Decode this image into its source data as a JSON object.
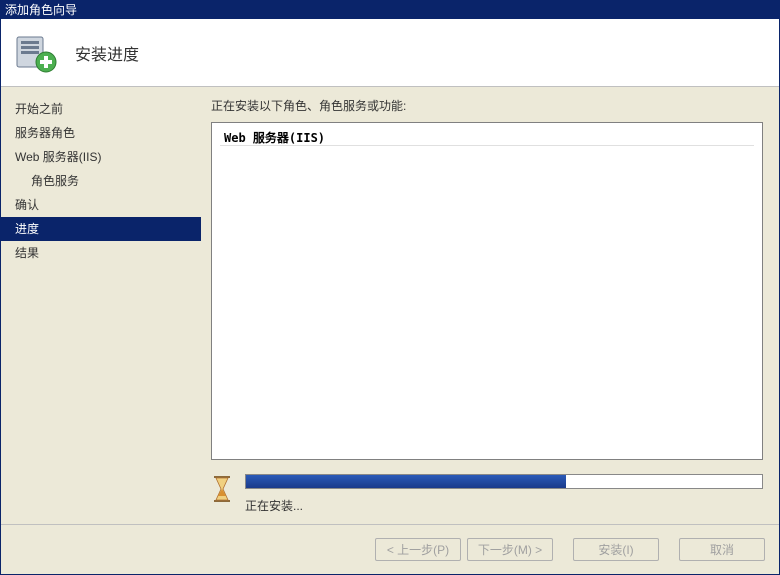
{
  "window": {
    "title": "添加角色向导"
  },
  "header": {
    "title": "安装进度"
  },
  "sidebar": {
    "items": [
      {
        "label": "开始之前"
      },
      {
        "label": "服务器角色"
      },
      {
        "label": "Web 服务器(IIS)"
      },
      {
        "label": "角色服务"
      },
      {
        "label": "确认"
      },
      {
        "label": "进度"
      },
      {
        "label": "结果"
      }
    ]
  },
  "main": {
    "label": "正在安装以下角色、角色服务或功能:",
    "listbox": {
      "items": [
        {
          "text": "Web 服务器(IIS)"
        }
      ]
    },
    "progress": {
      "percent": 62,
      "status": "正在安装..."
    }
  },
  "footer": {
    "prev": "< 上一步(P)",
    "next": "下一步(M) >",
    "install": "安装(I)",
    "cancel": "取消"
  }
}
